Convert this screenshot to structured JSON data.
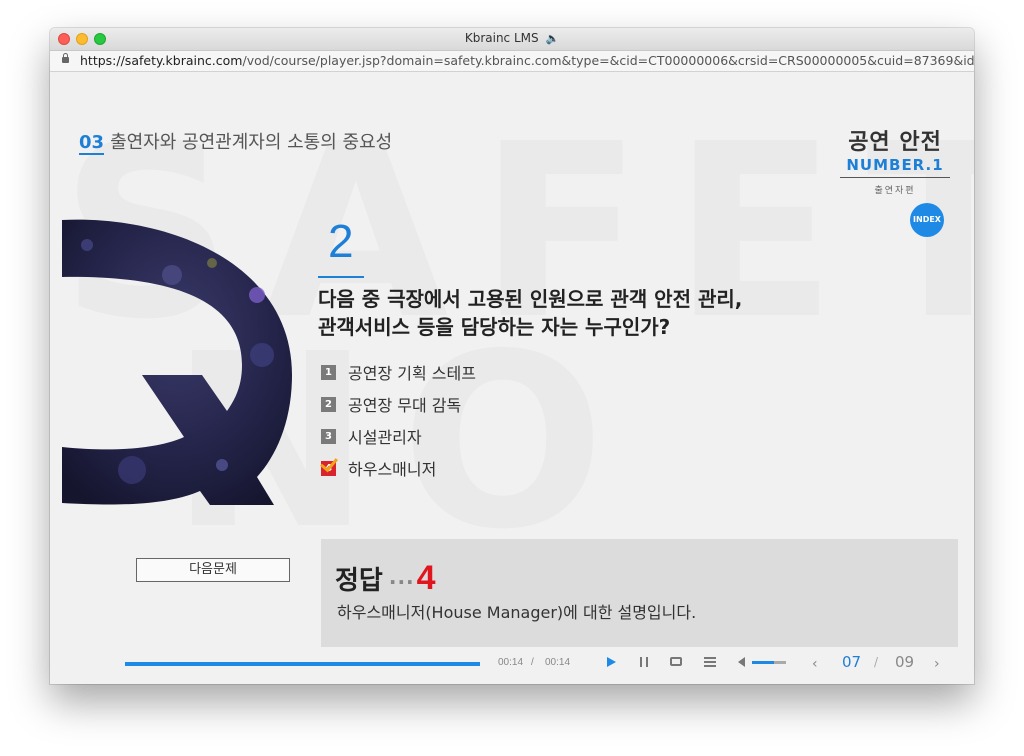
{
  "window": {
    "title": "Kbrainc LMS",
    "speaker_icon": "speaker-icon",
    "url_host": "https://safety.kbrainc.com",
    "url_path": "/vod/course/player.jsp?domain=safety.kbrainc.com&type=&cid=CT00000006&crsid=CRS00000005&cuid=87369&idx=3"
  },
  "section": {
    "number": "03",
    "title": "출연자와 공연관계자의 소통의 중요성"
  },
  "brand": {
    "title_ko": "공연 안전",
    "title_en": "NUMBER.1",
    "subtitle": "출연자편",
    "index_label": "INDEX"
  },
  "question": {
    "number": "2",
    "line1": "다음 중 극장에서 고용된 인원으로 관객 안전 관리,",
    "line2": "관객서비스 등을 담당하는 자는 누구인가?",
    "options": [
      {
        "num": "1",
        "label": "공연장 기획 스테프"
      },
      {
        "num": "2",
        "label": "공연장 무대 감독"
      },
      {
        "num": "3",
        "label": "시설관리자"
      },
      {
        "num": "4",
        "label": "하우스매니저"
      }
    ]
  },
  "answer": {
    "label": "정답",
    "dots": "···",
    "value": "4",
    "description": "하우스매니저(House Manager)에 대한 설명입니다."
  },
  "next_button": "다음문제",
  "player": {
    "progress": 1.0,
    "current_time": "00:14",
    "separator": "/",
    "total_time": "00:14",
    "volume": 0.65,
    "page_current": "07",
    "page_separator": "/",
    "page_total": "09",
    "prev_icon": "chevron-left-icon",
    "next_icon": "chevron-right-icon"
  },
  "colors": {
    "accent": "#1e7fd6",
    "answer_red": "#e0161f"
  }
}
